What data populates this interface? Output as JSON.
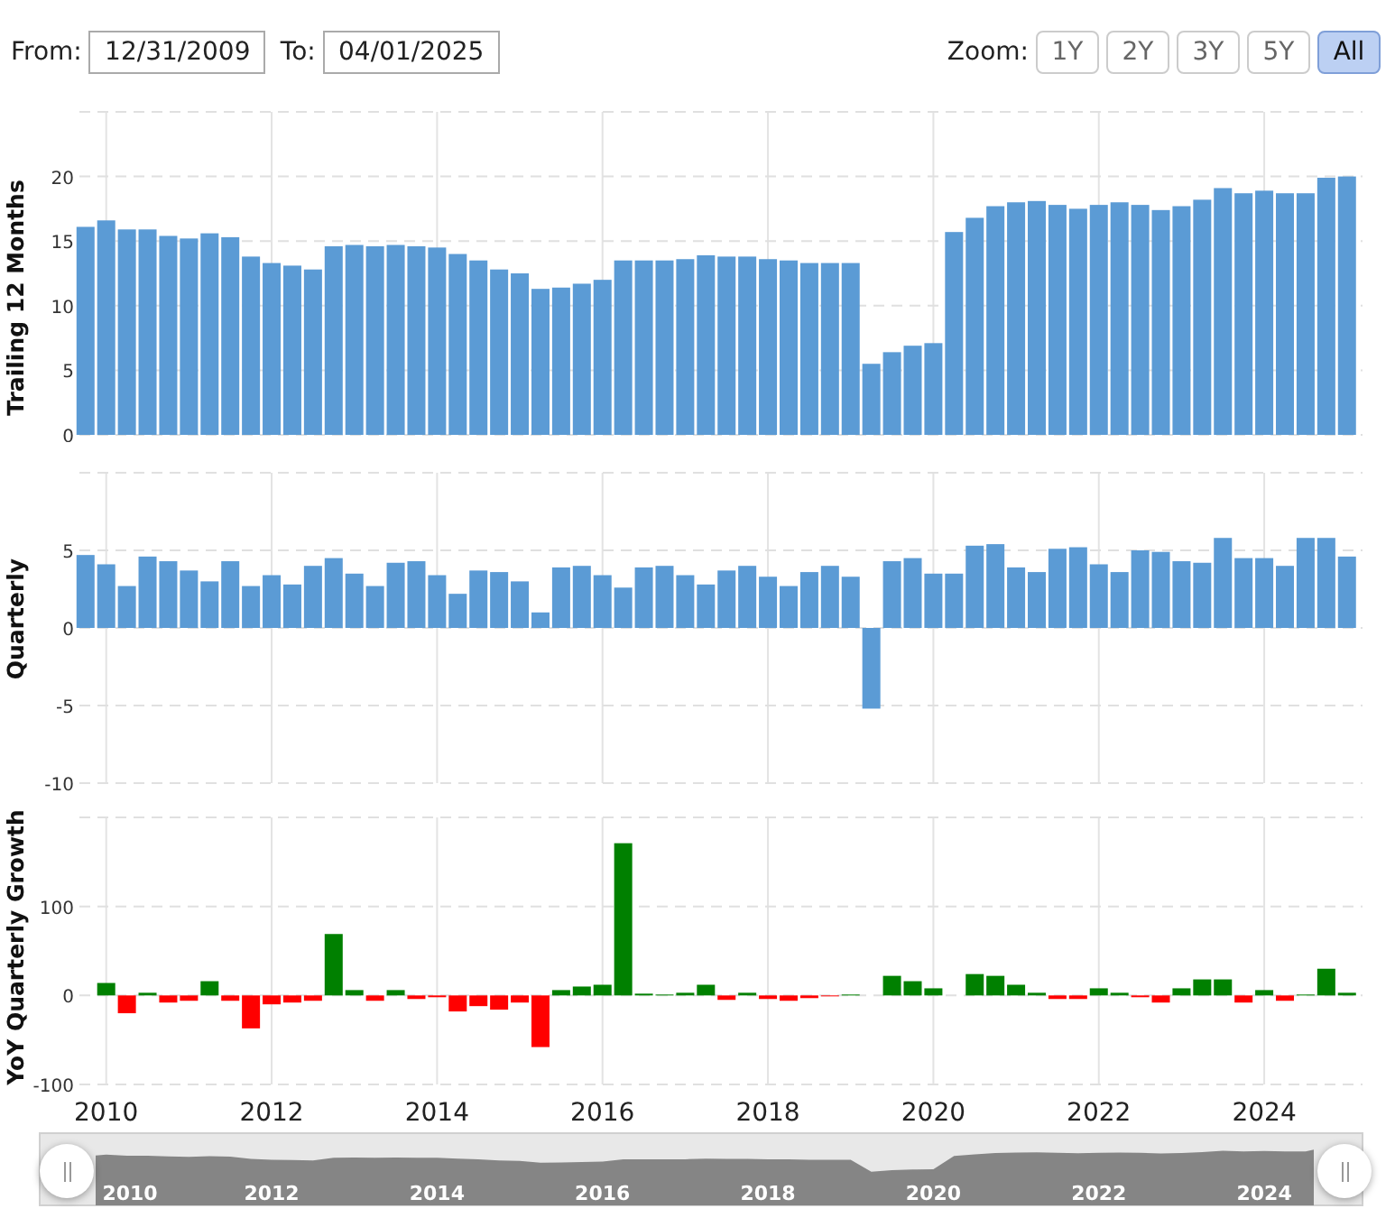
{
  "date_range": {
    "from_label": "From:",
    "from_value": "12/31/2009",
    "to_label": "To:",
    "to_value": "04/01/2025"
  },
  "zoom": {
    "label": "Zoom:",
    "buttons": [
      {
        "label": "1Y",
        "selected": false
      },
      {
        "label": "2Y",
        "selected": false
      },
      {
        "label": "3Y",
        "selected": false
      },
      {
        "label": "5Y",
        "selected": false
      },
      {
        "label": "All",
        "selected": true
      }
    ]
  },
  "panels": [
    {
      "chart_data": {
        "type": "bar",
        "ylabel": "Trailing 12 Months",
        "grid": true,
        "xlim": [
          2009.676,
          2025.188
        ],
        "ylim": [
          0,
          25
        ],
        "yticks": [
          0,
          5,
          10,
          15,
          20
        ],
        "x": [
          2009.75,
          2010,
          2010.25,
          2010.5,
          2010.75,
          2011,
          2011.25,
          2011.5,
          2011.75,
          2012,
          2012.25,
          2012.5,
          2012.75,
          2013,
          2013.25,
          2013.5,
          2013.75,
          2014,
          2014.25,
          2014.5,
          2014.75,
          2015,
          2015.25,
          2015.5,
          2015.75,
          2016,
          2016.25,
          2016.5,
          2016.75,
          2017,
          2017.25,
          2017.5,
          2017.75,
          2018,
          2018.25,
          2018.5,
          2018.75,
          2019,
          2019.25,
          2019.5,
          2019.75,
          2020,
          2020.25,
          2020.5,
          2020.75,
          2021,
          2021.25,
          2021.5,
          2021.75,
          2022,
          2022.25,
          2022.5,
          2022.75,
          2023,
          2023.25,
          2023.5,
          2023.75,
          2024,
          2024.25,
          2024.5,
          2024.75,
          2025
        ],
        "series": [
          {
            "color": "#5b9bd5",
            "values": [
              16.1,
              16.6,
              15.9,
              15.9,
              15.4,
              15.2,
              15.6,
              15.3,
              13.8,
              13.3,
              13.1,
              12.8,
              14.6,
              14.7,
              14.6,
              14.7,
              14.6,
              14.5,
              14.0,
              13.5,
              12.8,
              12.5,
              11.3,
              11.4,
              11.7,
              12.0,
              13.5,
              13.5,
              13.5,
              13.6,
              13.9,
              13.8,
              13.8,
              13.6,
              13.5,
              13.3,
              13.3,
              13.3,
              5.5,
              6.4,
              6.9,
              7.1,
              15.7,
              16.8,
              17.7,
              18.0,
              18.1,
              17.8,
              17.5,
              17.8,
              18.0,
              17.8,
              17.4,
              17.7,
              18.2,
              19.1,
              18.7,
              18.9,
              18.7,
              18.7,
              19.9,
              20.0
            ]
          }
        ]
      }
    },
    {
      "chart_data": {
        "type": "bar",
        "ylabel": "Quarterly",
        "grid": true,
        "xlim": [
          2009.676,
          2025.188
        ],
        "ylim": [
          -10,
          10
        ],
        "yticks": [
          -10,
          -5,
          0,
          5
        ],
        "x": [
          2009.75,
          2010,
          2010.25,
          2010.5,
          2010.75,
          2011,
          2011.25,
          2011.5,
          2011.75,
          2012,
          2012.25,
          2012.5,
          2012.75,
          2013,
          2013.25,
          2013.5,
          2013.75,
          2014,
          2014.25,
          2014.5,
          2014.75,
          2015,
          2015.25,
          2015.5,
          2015.75,
          2016,
          2016.25,
          2016.5,
          2016.75,
          2017,
          2017.25,
          2017.5,
          2017.75,
          2018,
          2018.25,
          2018.5,
          2018.75,
          2019,
          2019.25,
          2019.5,
          2019.75,
          2020,
          2020.25,
          2020.5,
          2020.75,
          2021,
          2021.25,
          2021.5,
          2021.75,
          2022,
          2022.25,
          2022.5,
          2022.75,
          2023,
          2023.25,
          2023.5,
          2023.75,
          2024,
          2024.25,
          2024.5,
          2024.75,
          2025
        ],
        "series": [
          {
            "color": "#5b9bd5",
            "values": [
              4.7,
              4.1,
              2.7,
              4.6,
              4.3,
              3.7,
              3.0,
              4.3,
              2.7,
              3.4,
              2.8,
              4.0,
              4.5,
              3.5,
              2.7,
              4.2,
              4.3,
              3.4,
              2.2,
              3.7,
              3.6,
              3.0,
              1.0,
              3.9,
              4.0,
              3.4,
              2.6,
              3.9,
              4.0,
              3.4,
              2.8,
              3.7,
              4.0,
              3.3,
              2.7,
              3.6,
              4.0,
              3.3,
              -5.2,
              4.3,
              4.5,
              3.5,
              3.5,
              5.3,
              5.4,
              3.9,
              3.6,
              5.1,
              5.2,
              4.1,
              3.6,
              5.0,
              4.9,
              4.3,
              4.2,
              5.8,
              4.5,
              4.5,
              4.0,
              5.8,
              5.8,
              4.6
            ]
          }
        ]
      }
    },
    {
      "chart_data": {
        "type": "bar",
        "ylabel": "YoY Quarterly Growth",
        "grid": true,
        "xlim": [
          2009.676,
          2025.188
        ],
        "ylim": [
          -100,
          200
        ],
        "xticks": [
          2010,
          2012,
          2014,
          2016,
          2018,
          2020,
          2022,
          2024
        ],
        "yticks": [
          -100,
          0,
          100
        ],
        "x": [
          2010,
          2010.25,
          2010.5,
          2010.75,
          2011,
          2011.25,
          2011.5,
          2011.75,
          2012,
          2012.25,
          2012.5,
          2012.75,
          2013,
          2013.25,
          2013.5,
          2013.75,
          2014,
          2014.25,
          2014.5,
          2014.75,
          2015,
          2015.25,
          2015.5,
          2015.75,
          2016,
          2016.25,
          2016.5,
          2016.75,
          2017,
          2017.25,
          2017.5,
          2017.75,
          2018,
          2018.25,
          2018.5,
          2018.75,
          2019,
          2019.25,
          2019.5,
          2019.75,
          2020,
          2020.25,
          2020.5,
          2020.75,
          2021,
          2021.25,
          2021.5,
          2021.75,
          2022,
          2022.25,
          2022.5,
          2022.75,
          2023,
          2023.25,
          2023.5,
          2023.75,
          2024,
          2024.25,
          2024.5,
          2024.75,
          2025
        ],
        "series": [
          {
            "color": "#008000",
            "values": [
              14,
              null,
              3,
              null,
              null,
              16,
              null,
              null,
              null,
              null,
              null,
              69,
              6,
              null,
              6,
              null,
              null,
              null,
              null,
              null,
              null,
              null,
              6,
              10,
              12,
              171,
              2,
              1,
              3,
              12,
              null,
              3,
              null,
              null,
              null,
              null,
              1,
              null,
              22,
              16,
              8,
              null,
              24,
              22,
              12,
              3,
              null,
              null,
              8,
              3,
              null,
              null,
              8,
              18,
              18,
              null,
              6,
              null,
              1,
              30,
              3
            ]
          },
          {
            "color": "#ff0000",
            "values": [
              null,
              -20,
              null,
              -8,
              -6,
              null,
              -6,
              -37,
              -10,
              -8,
              -6,
              null,
              null,
              -6,
              null,
              -4,
              -2,
              -18,
              -12,
              -16,
              -8,
              -58,
              null,
              null,
              null,
              null,
              null,
              null,
              null,
              null,
              -5,
              null,
              -4,
              -6,
              -3,
              -1,
              null,
              null,
              null,
              null,
              null,
              null,
              null,
              null,
              null,
              null,
              -4,
              -4,
              null,
              null,
              -2,
              -8,
              null,
              null,
              null,
              -8,
              null,
              -6,
              null,
              null,
              null
            ]
          }
        ]
      }
    }
  ],
  "navigator": {
    "labels": [
      "2010",
      "2012",
      "2014",
      "2016",
      "2018",
      "2020",
      "2022",
      "2024"
    ]
  }
}
